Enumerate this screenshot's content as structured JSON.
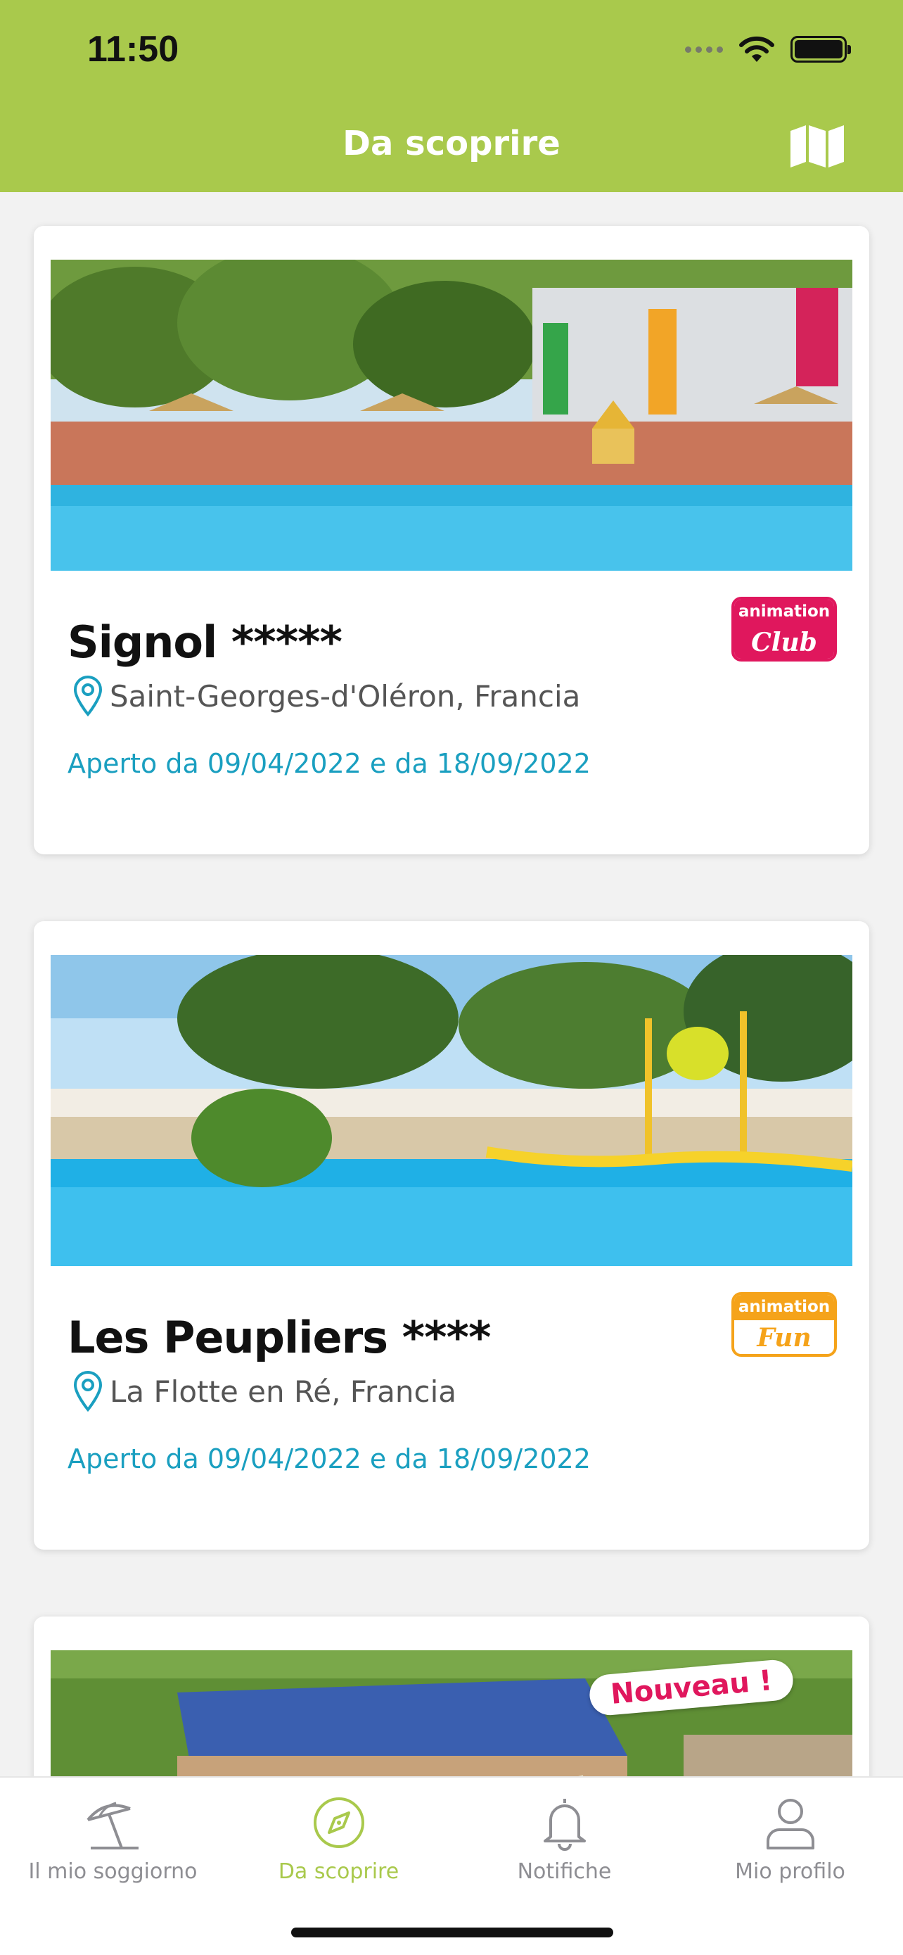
{
  "status_bar": {
    "time": "11:50"
  },
  "header": {
    "title": "Da scoprire",
    "map_icon": "map-icon",
    "background": "#a9c94c"
  },
  "cards": [
    {
      "name": "Signol *****",
      "location": "Saint-Georges-d'Oléron, Francia",
      "open": "Aperto da 09/04/2022 e da 18/09/2022",
      "badge_top": "animation",
      "badge_bottom": "Club",
      "badge_color": "#e0175d"
    },
    {
      "name": "Les Peupliers ****",
      "location": "La Flotte en Ré, Francia",
      "open": "Aperto da 09/04/2022 e da 18/09/2022",
      "badge_top": "animation",
      "badge_bottom": "Fun",
      "badge_color": "#f5a31a"
    },
    {
      "photo_tag": "Nouveau !"
    }
  ],
  "tabbar": {
    "items": [
      {
        "label": "Il mio soggiorno",
        "icon": "umbrella-icon",
        "active": false
      },
      {
        "label": "Da scoprire",
        "icon": "compass-icon",
        "active": true
      },
      {
        "label": "Notifiche",
        "icon": "bell-icon",
        "active": false
      },
      {
        "label": "Mio profilo",
        "icon": "user-icon",
        "active": false
      }
    ],
    "active_color": "#a9c94c",
    "inactive_color": "#8e8e93"
  }
}
